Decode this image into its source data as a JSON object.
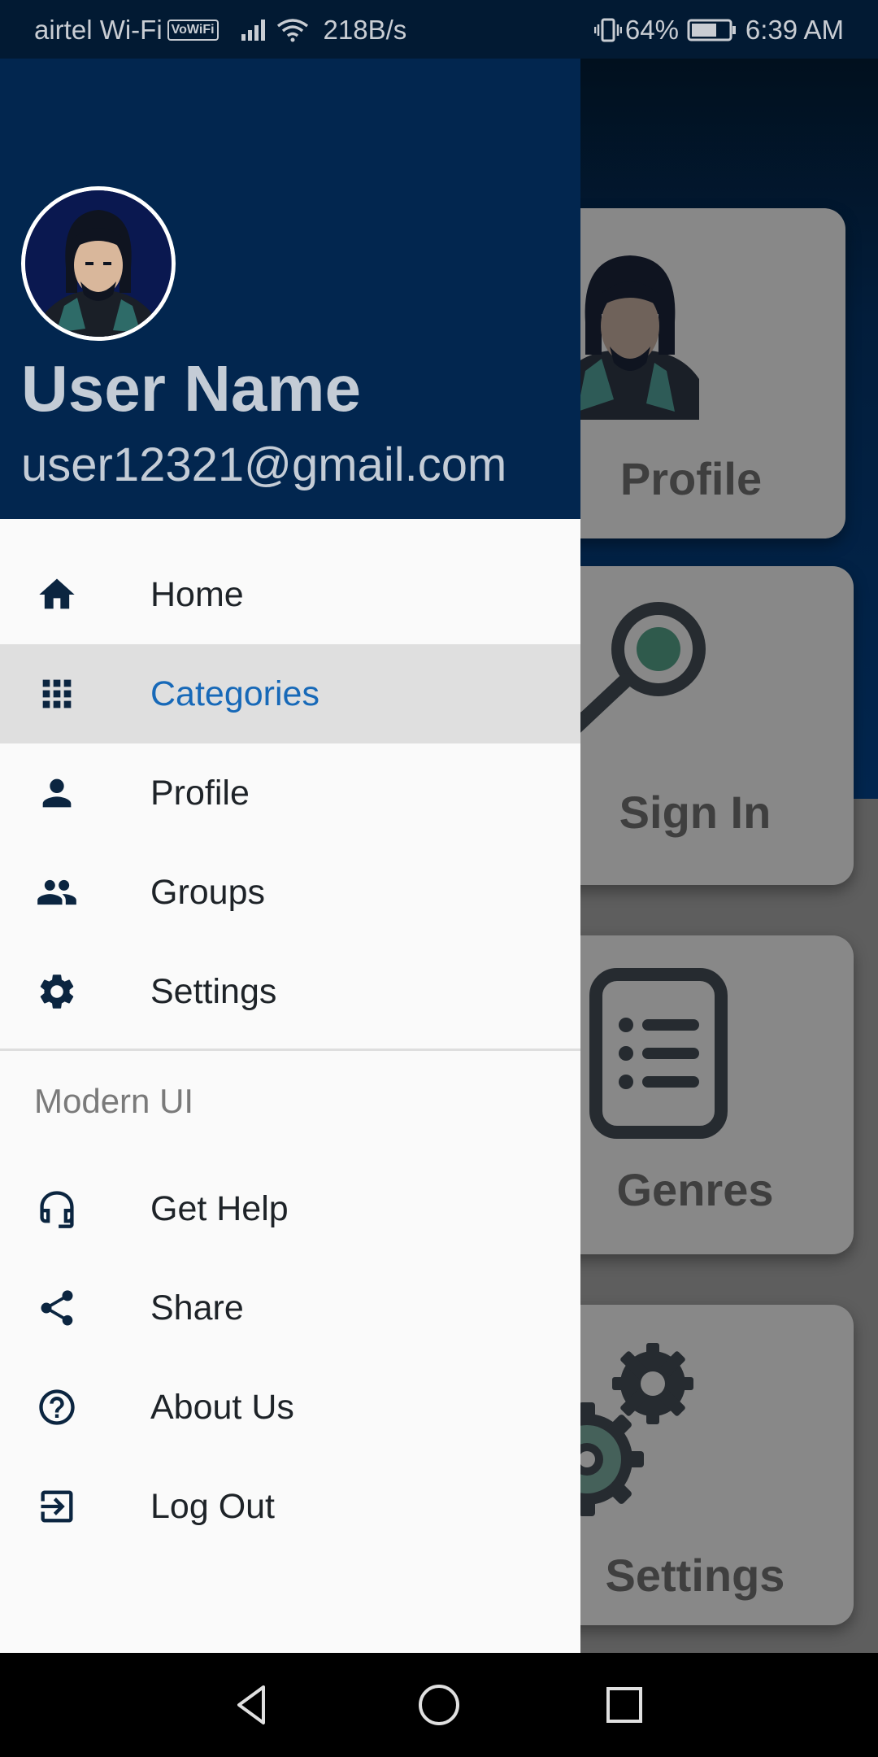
{
  "status_bar": {
    "carrier": "airtel Wi-Fi",
    "vowifi_badge": "VoWiFi",
    "net_speed": "218B/s",
    "battery": "64%",
    "time": "6:39 AM"
  },
  "drawer": {
    "user_name": "User Name",
    "user_email": "user12321@gmail.com",
    "nav_items": [
      {
        "label": "Home",
        "icon": "home-icon"
      },
      {
        "label": "Categories",
        "icon": "grid-icon",
        "active": true
      },
      {
        "label": "Profile",
        "icon": "person-icon"
      },
      {
        "label": "Groups",
        "icon": "group-icon"
      },
      {
        "label": "Settings",
        "icon": "gear-icon"
      }
    ],
    "section_title": "Modern UI",
    "section_items": [
      {
        "label": "Get Help",
        "icon": "headset-icon"
      },
      {
        "label": "Share",
        "icon": "share-icon"
      },
      {
        "label": "About Us",
        "icon": "help-circle-icon"
      },
      {
        "label": "Log Out",
        "icon": "logout-icon"
      }
    ]
  },
  "background_cards": {
    "profile": "Profile",
    "sign_in": "Sign In",
    "genres": "Genres",
    "settings": "Settings"
  },
  "colors": {
    "header_navy": "#02264f",
    "active_accent": "#1769b8",
    "active_row_bg": "#dfdfdf",
    "icon_navy": "#0b2540"
  }
}
